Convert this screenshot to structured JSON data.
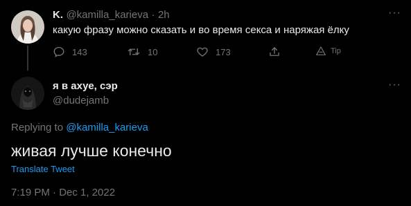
{
  "parent": {
    "name": "K.",
    "handle": "@kamilla_karieva",
    "separator": "·",
    "time": "2h",
    "text": "какую фразу можно сказать и во время секса и наряжая ёлку",
    "actions": {
      "replies": "143",
      "retweets": "10",
      "likes": "173",
      "tip": "Tip"
    }
  },
  "reply": {
    "name": "я в ахуе, сэр",
    "handle": "@dudejamb",
    "replying_prefix": "Replying to",
    "replying_to": "@kamilla_karieva",
    "text": "живая лучше конечно",
    "translate": "Translate Tweet",
    "timestamp": "7:19 PM · Dec 1, 2022"
  },
  "menu_dots": "···",
  "colors": {
    "background": "#000000",
    "text": "#e7e9ea",
    "muted": "#71767b",
    "accent": "#1d9bf0",
    "thread_line": "#333639"
  }
}
